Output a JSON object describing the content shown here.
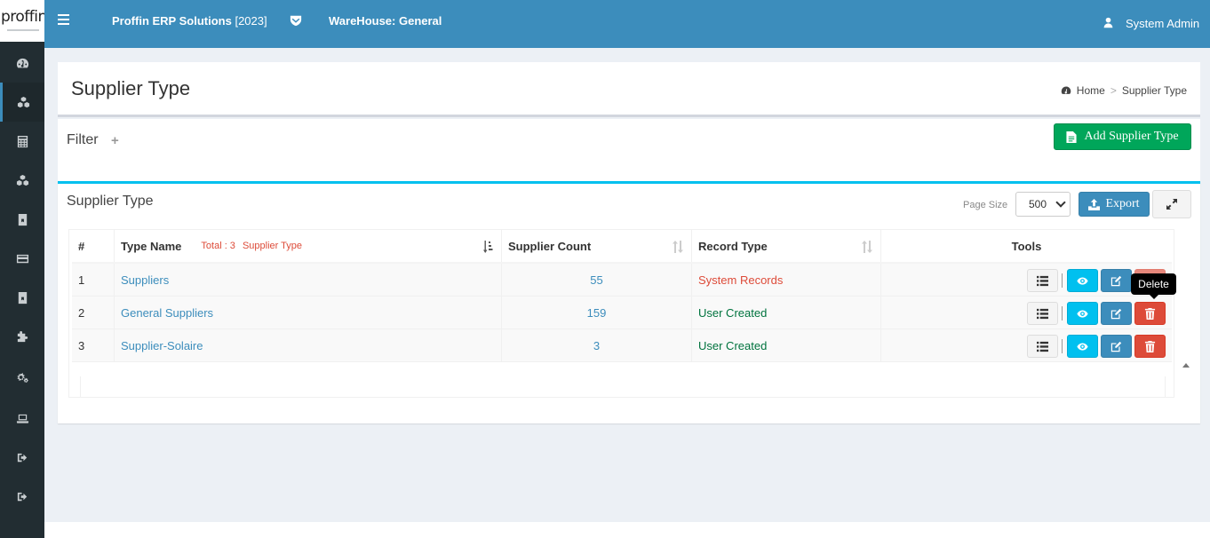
{
  "logo": {
    "text": "proffin"
  },
  "header": {
    "brand_name": "Proffin ERP Solutions",
    "brand_year": "[2023]",
    "warehouse": "WareHouse: General",
    "user": "System Admin"
  },
  "sidebar": {
    "items": [
      {
        "icon": "dashboard-icon"
      },
      {
        "icon": "cubes-icon",
        "active": true
      },
      {
        "icon": "calculator-icon"
      },
      {
        "icon": "cubes-icon"
      },
      {
        "icon": "box-icon"
      },
      {
        "icon": "credit-card-icon"
      },
      {
        "icon": "box-icon"
      },
      {
        "icon": "puzzle-icon"
      },
      {
        "icon": "gears-icon"
      },
      {
        "icon": "laptop-icon"
      },
      {
        "icon": "sign-out-icon"
      },
      {
        "icon": "sign-out-icon"
      }
    ]
  },
  "page": {
    "title": "Supplier Type",
    "breadcrumb": {
      "home": "Home",
      "sep": ">",
      "current": "Supplier Type"
    }
  },
  "filter": {
    "label": "Filter",
    "plus": "+",
    "add_button": "Add Supplier Type"
  },
  "list": {
    "title": "Supplier Type",
    "page_size_label": "Page Size",
    "page_size_value": "500",
    "export_label": "Export",
    "columns": {
      "no": "#",
      "name": "Type Name",
      "total_label": "Total : 3",
      "total_entity": "Supplier Type",
      "count": "Supplier Count",
      "record": "Record Type",
      "tools": "Tools"
    },
    "rows": [
      {
        "no": "1",
        "name": "Suppliers",
        "count": "55",
        "record": "System Records"
      },
      {
        "no": "2",
        "name": "General Suppliers",
        "count": "159",
        "record": "User Created"
      },
      {
        "no": "3",
        "name": "Supplier-Solaire",
        "count": "3",
        "record": "User Created"
      }
    ],
    "tooltip": "Delete"
  },
  "colors": {
    "header": "#3c8dbc",
    "sidebar": "#222d32",
    "success": "#00a65a",
    "info": "#00c0ef",
    "danger": "#dd4b39"
  }
}
